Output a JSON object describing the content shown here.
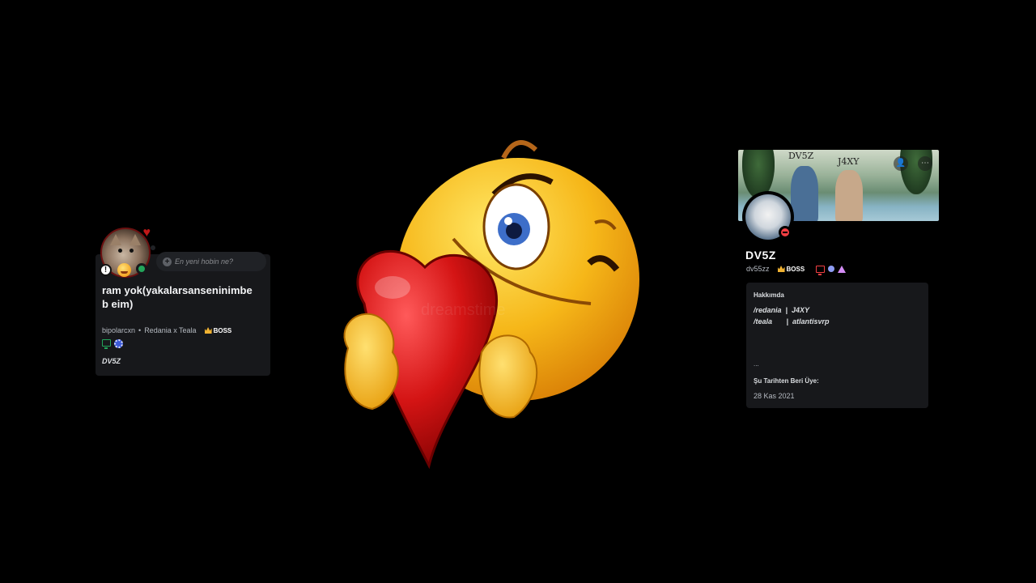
{
  "left_profile": {
    "status_placeholder": "En yeni hobin ne?",
    "display_name": "ram yok(yakalarsanseninimbeb eim)",
    "username": "bipolarcxn",
    "separator": "•",
    "server": "Redania x Teala",
    "tag": "BOSS",
    "note": "DV5Z",
    "status": "online"
  },
  "right_profile": {
    "banner_text_a": "DV5Z",
    "banner_text_b": "J4XY",
    "display_name": "DV5Z",
    "username": "dv55zz",
    "tag": "BOSS",
    "status": "do-not-disturb",
    "about_title": "Hakkımda",
    "about_lines": [
      "/redania  |  J4XY",
      "/teala       |  atlantisvrp"
    ],
    "about_extra": "...",
    "member_since_title": "Şu Tarihten Beri Üye:",
    "member_since_date": "28 Kas 2021"
  },
  "center": {
    "watermark": "dreamstime"
  },
  "colors": {
    "background": "#000000",
    "card": "#17181b",
    "online": "#23a55a",
    "dnd": "#f23f43",
    "boss_crown": "#f0b232"
  }
}
